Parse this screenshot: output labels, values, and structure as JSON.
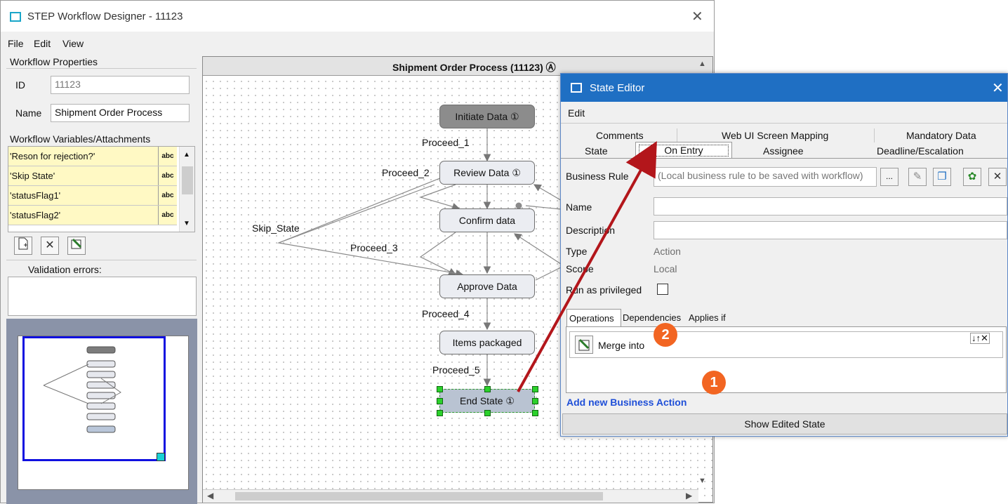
{
  "main_window": {
    "title": "STEP Workflow Designer - 11123",
    "close": "✕",
    "menu": [
      "File",
      "Edit",
      "View"
    ]
  },
  "workflow_properties": {
    "title": "Workflow Properties",
    "id_label": "ID",
    "id_value": "11123",
    "name_label": "Name",
    "name_value": "Shipment Order Process"
  },
  "variables": {
    "title": "Workflow Variables/Attachments",
    "rows": [
      "'Reson for rejection?'",
      "'Skip State'",
      "'statusFlag1'",
      "'statusFlag2'"
    ],
    "type_label": "abc"
  },
  "validation": {
    "title": "Validation errors:"
  },
  "canvas": {
    "header": "Shipment Order Process (11123) Ⓐ",
    "nodes": {
      "initiate": "Initiate Data ①",
      "review": "Review Data ①",
      "confirm": "Confirm data",
      "approve": "Approve Data",
      "items": "Items packaged",
      "end": "End State ①"
    },
    "edges": {
      "p1": "Proceed_1",
      "p2": "Proceed_2",
      "p3": "Proceed_3",
      "p4": "Proceed_4",
      "p5": "Proceed_5",
      "skip": "Skip_State"
    }
  },
  "state_editor": {
    "title": "State Editor",
    "close": "✕",
    "menu": "Edit",
    "tabs_top": [
      "Comments",
      "Web UI Screen Mapping",
      "Mandatory Data"
    ],
    "tabs_bottom": [
      "State",
      "On Entry",
      "Assignee",
      "Deadline/Escalation"
    ],
    "business_rule_label": "Business Rule",
    "business_rule_placeholder": "(Local business rule to be saved with workflow)",
    "browse": "...",
    "name_label": "Name",
    "description_label": "Description",
    "type_label": "Type",
    "type_value": "Action",
    "scope_label": "Scope",
    "scope_value": "Local",
    "privileged_label": "Run as privileged",
    "subtabs": [
      "Operations",
      "Dependencies",
      "Applies if"
    ],
    "operation": "Merge  into",
    "order_controls": "↓↑✕",
    "add_action": "Add new Business Action",
    "show_edited": "Show Edited State",
    "badge1": "1",
    "badge2": "2"
  }
}
